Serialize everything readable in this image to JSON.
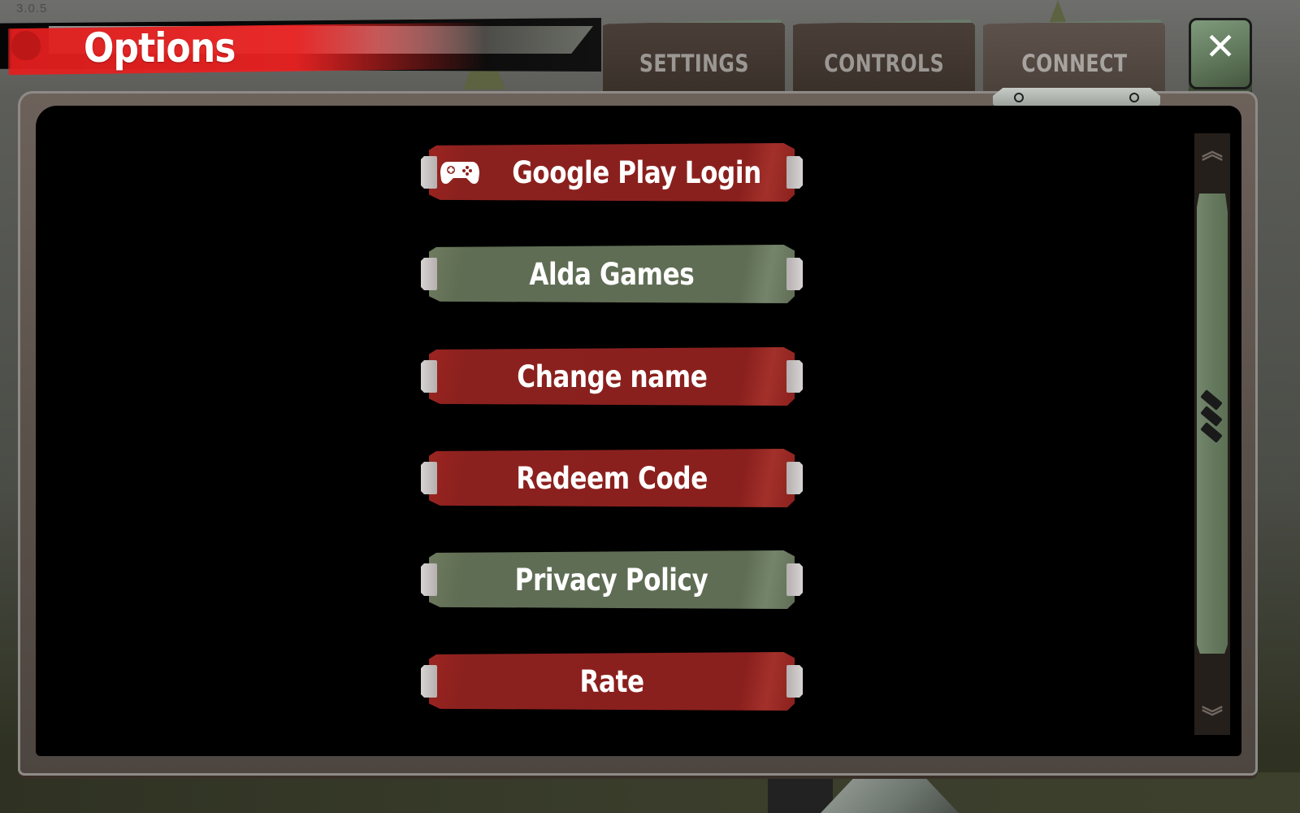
{
  "version": "3.0.5",
  "header": {
    "title": "Options"
  },
  "tabs": [
    {
      "label": "SETTINGS",
      "active": false
    },
    {
      "label": "CONTROLS",
      "active": false
    },
    {
      "label": "CONNECT",
      "active": true
    }
  ],
  "close_button": {
    "icon": "close-icon",
    "glyph": "✕"
  },
  "connect_panel": {
    "buttons": [
      {
        "label": "Google Play Login",
        "style": "red",
        "icon": "gamepad-icon"
      },
      {
        "label": "Alda Games",
        "style": "green"
      },
      {
        "label": "Change name",
        "style": "red"
      },
      {
        "label": "Redeem Code",
        "style": "red"
      },
      {
        "label": "Privacy Policy",
        "style": "green"
      },
      {
        "label": "Rate",
        "style": "red"
      }
    ]
  },
  "scrollbar": {
    "up_glyph": "︽",
    "down_glyph": "︾",
    "position": 0.0
  },
  "colors": {
    "button_red": "#8b211e",
    "button_green": "#5f6d54",
    "tab_bg": "#3a302a",
    "tab_text": "#9b9793",
    "header_red": "#e21e1e",
    "panel_frame": "#5b514b",
    "scroll_thumb": "#667a5f"
  }
}
